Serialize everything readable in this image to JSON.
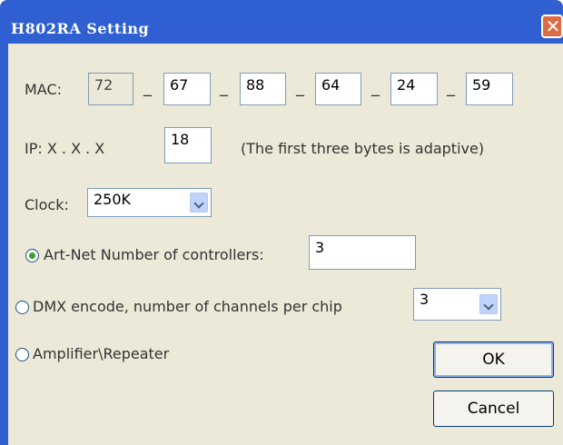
{
  "window": {
    "title": "H802RA Setting",
    "close_glyph": "✕"
  },
  "mac": {
    "label": "MAC:",
    "separator": "_",
    "bytes": [
      "72",
      "67",
      "88",
      "64",
      "24",
      "59"
    ]
  },
  "ip": {
    "label": "IP:  X  .  X  .  X",
    "last_byte": "18",
    "note": "(The first three bytes  is adaptive)"
  },
  "clock": {
    "label": "Clock:",
    "selected": "250K"
  },
  "modes": {
    "artnet": {
      "label": "Art-Net Number of controllers:",
      "value": "3",
      "selected": true
    },
    "dmx": {
      "label": "DMX encode, number of channels per chip",
      "value": "3",
      "selected": false
    },
    "amplifier": {
      "label": "Amplifier\\Repeater",
      "selected": false
    }
  },
  "buttons": {
    "ok": "OK",
    "cancel": "Cancel"
  },
  "colors": {
    "titlebar": "#2f5fd0",
    "client": "#ece9d8",
    "close": "#e06a43",
    "radio_dot": "#2fa22f"
  }
}
